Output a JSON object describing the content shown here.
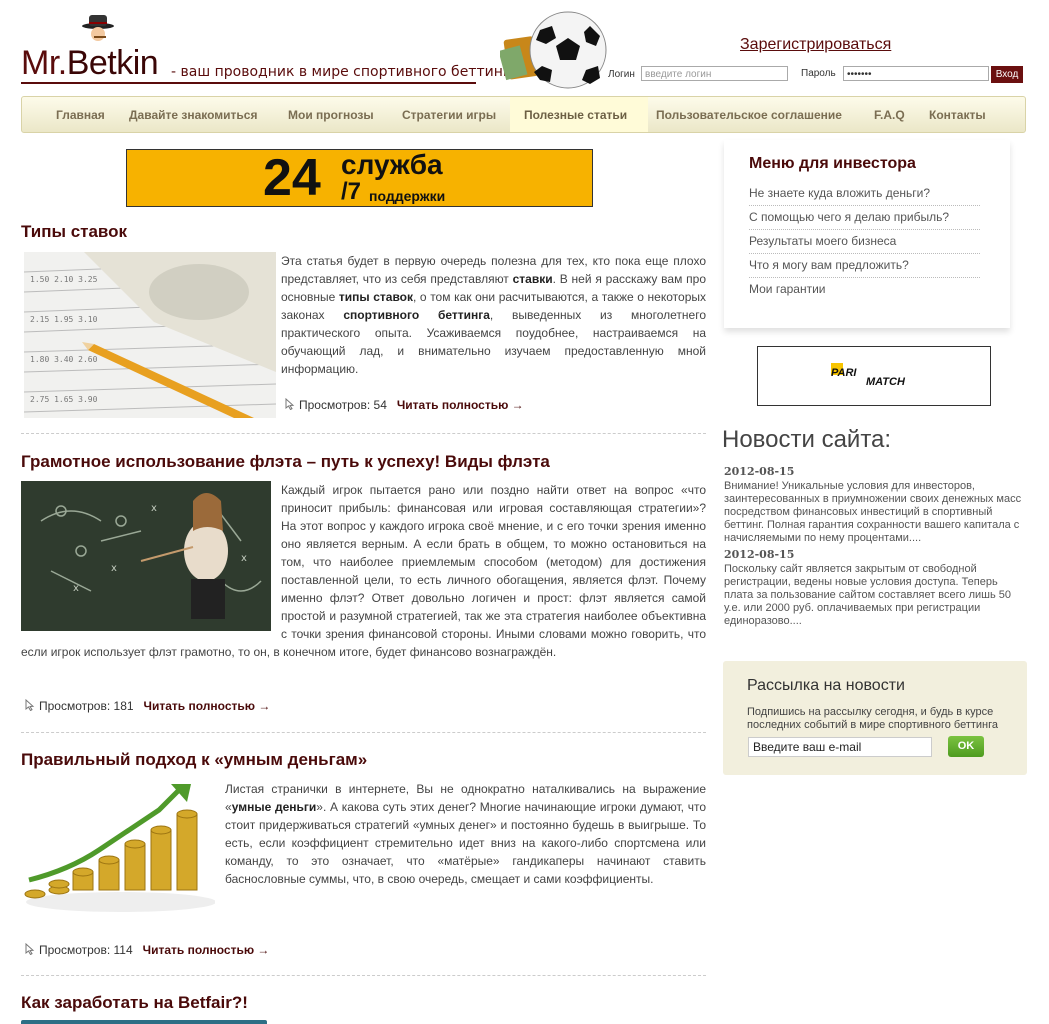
{
  "header": {
    "logo_mr": "Mr.",
    "logo_betkin": "Betkin",
    "tagline": "- ваш проводник в мире спортивного беттинга.",
    "register_link": "Зарегистрироваться",
    "login_label": "Логин",
    "login_placeholder": "введите логин",
    "password_label": "Пароль",
    "password_value": "•••••••",
    "login_button": "Вход"
  },
  "nav": {
    "items": [
      {
        "label": "Главная"
      },
      {
        "label": "Давайте знакомиться"
      },
      {
        "label": "Мои прогнозы"
      },
      {
        "label": "Стратегии игры"
      },
      {
        "label": "Полезные статьи",
        "active": true
      },
      {
        "label": "Пользовательское соглашение"
      },
      {
        "label": "F.A.Q"
      },
      {
        "label": "Контакты"
      }
    ]
  },
  "banner": {
    "num": "24",
    "word": "служба",
    "slash7": "/7",
    "word2": "поддержки"
  },
  "articles": [
    {
      "title": "Типы ставок",
      "views_label": "Просмотров: 54",
      "more_label": "Читать полностью →"
    },
    {
      "title": "Грамотное использование флэта – путь к успеху! Виды флэта",
      "text": "Каждый игрок пытается рано или поздно найти ответ на вопрос «что приносит прибыль: финансовая или игровая составляющая стратегии»? На этот вопрос у каждого игрока своё мнение, и с его точки зрения именно оно является верным. А если брать в общем, то можно остановиться на том, что наиболее приемлемым способом (методом) для достижения поставленной цели, то есть личного обогащения, является флэт. Почему именно флэт? Ответ довольно логичен и прост: флэт является самой простой и разумной стратегией, так же эта стратегия наиболее объективна с точки зрения финансовой стороны. Иными словами можно говорить, что если игрок использует флэт грамотно, то он, в конечном итоге, будет финансово вознаграждён.",
      "views_label": "Просмотров: 181",
      "more_label": "Читать полностью →"
    },
    {
      "title": "Правильный подход к «умным деньгам»",
      "views_label": "Просмотров: 114",
      "more_label": "Читать полностью →"
    },
    {
      "title": "Как заработать на Betfair?!"
    }
  ],
  "article1_text": {
    "p1": "Эта статья будет в первую очередь полезна для тех, кто пока еще плохо представляет, что из себя представляют ",
    "b1": "ставки",
    "p2": ". В ней я расскажу вам про основные ",
    "b2": "типы ставок",
    "p3": ", о том как они расчитываются, а также о некоторых законах ",
    "b3": "спортивного беттинга",
    "p4": ", выведенных из многолетнего практического опыта. Усаживаемся поудобнее, настраиваемся на обучающий лад, и внимательно изучаем предоставленную мной информацию."
  },
  "article3_text": {
    "p1": "Листая странички в интернете, Вы не однократно наталкивались на выражение «",
    "b1": "умные деньги",
    "p2": "». А какова суть этих денег? Многие начинающие игроки думают, что стоит придерживаться стратегий «умных денег» и постоянно будешь в выигрыше. То есть, если коэффициент стремительно идет вниз на какого-либо спортсмена или команду, то это означает, что «матёрые» гандикаперы начинают ставить баснословные суммы, что, в свою очередь, смещает и сами коэффициенты."
  },
  "investor_menu": {
    "title": "Меню для инвестора",
    "items": [
      "Не знаете куда вложить деньги?",
      "С помощью чего я делаю прибыль?",
      "Результаты моего бизнеса",
      "Что я могу вам предложить?",
      "Мои гарантии"
    ]
  },
  "partner": {
    "line1": "PARI",
    "line2": "MATCH"
  },
  "news": {
    "title": "Новости сайта:",
    "items": [
      {
        "date": "2012-08-15",
        "text": "Внимание! Уникальные условия для инвесторов, заинтересованных в приумножении своих денежных масс посредством финансовых инвестиций в спортивный беттинг. Полная гарантия сохранности вашего капитала с начисляемыми по нему процентами...."
      },
      {
        "date": "2012-08-15",
        "text": "Поскольку сайт является закрытым от свободной регистрации, ведены новые условия доступа. Теперь плата за пользование сайтом составляет всего лишь 50 у.е. или 2000 руб. оплачиваемых при регистрации единоразово...."
      }
    ]
  },
  "subscribe": {
    "title": "Рассылка на новости",
    "text": "Подпишись на рассылку сегодня, и будь в курсе последних событий в мире спортивного беттинга",
    "email_value": "Введите ваш e-mail",
    "ok_label": "OK"
  }
}
